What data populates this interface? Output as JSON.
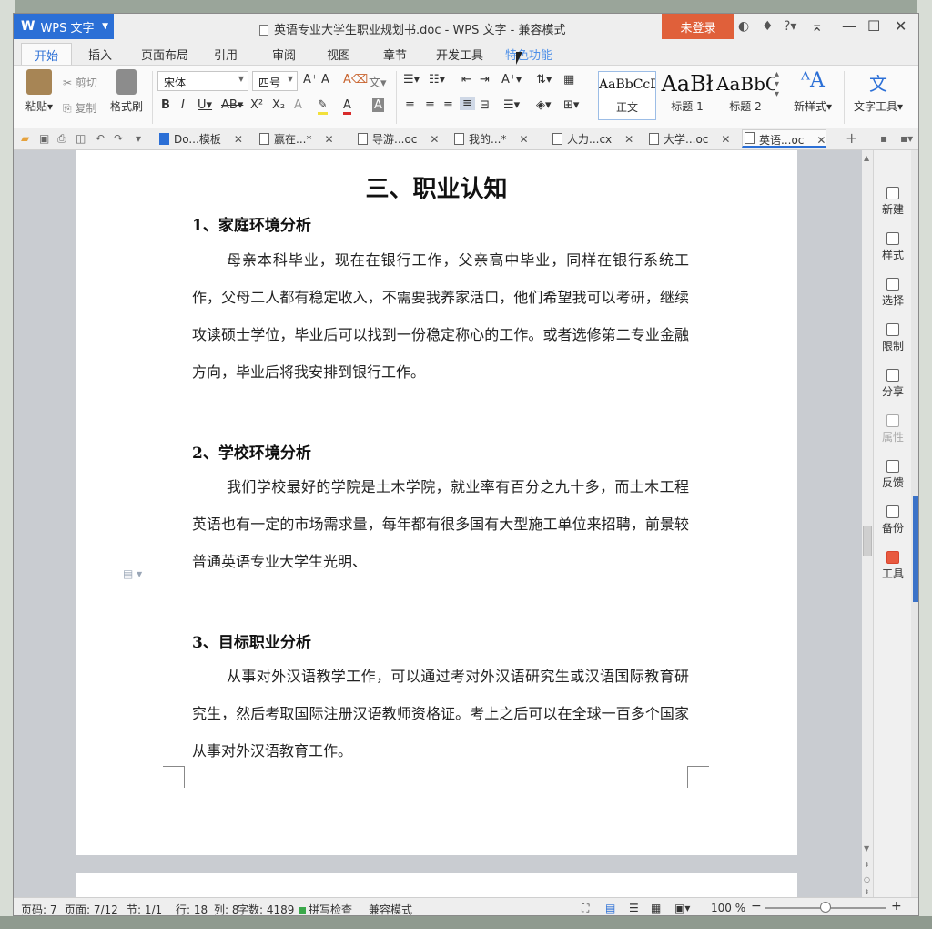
{
  "app": {
    "name": "WPS 文字",
    "logo": "W"
  },
  "window": {
    "title": "英语专业大学生职业规划书.doc - WPS 文字 - 兼容模式",
    "login_label": "未登录"
  },
  "ribbon_tabs": [
    "开始",
    "插入",
    "页面布局",
    "引用",
    "审阅",
    "视图",
    "章节",
    "开发工具",
    "特色功能"
  ],
  "ribbon": {
    "paste": "粘贴",
    "cut": "剪切",
    "copy": "复制",
    "format_painter": "格式刷",
    "font_name": "宋体",
    "font_size": "四号",
    "styles": [
      {
        "sample": "AaBbCcD",
        "label": "正文"
      },
      {
        "sample": "AaBł",
        "label": "标题 1"
      },
      {
        "sample": "AaBbC",
        "label": "标题 2"
      }
    ],
    "new_style": "新样式",
    "text_tools": "文字工具"
  },
  "doc_tabs": [
    {
      "label": "Do...模板",
      "active": false
    },
    {
      "label": "赢在...*",
      "active": false
    },
    {
      "label": "导游...oc",
      "active": false
    },
    {
      "label": "我的...*",
      "active": false
    },
    {
      "label": "人力...cx",
      "active": false
    },
    {
      "label": "大学...oc",
      "active": false
    },
    {
      "label": "英语...oc",
      "active": true
    }
  ],
  "document": {
    "heading": "三、职业认知",
    "sections": [
      {
        "title": "1、家庭环境分析",
        "text": "母亲本科毕业，现在在银行工作，父亲高中毕业，同样在银行系统工作，父母二人都有稳定收入，不需要我养家活口，他们希望我可以考研，继续攻读硕士学位，毕业后可以找到一份稳定称心的工作。或者选修第二专业金融方向，毕业后将我安排到银行工作。"
      },
      {
        "title": "2、学校环境分析",
        "text": "我们学校最好的学院是土木学院，就业率有百分之九十多，而土木工程英语也有一定的市场需求量，每年都有很多国有大型施工单位来招聘，前景较普通英语专业大学生光明、"
      },
      {
        "title": "3、目标职业分析",
        "text": "从事对外汉语教学工作，可以通过考对外汉语研究生或汉语国际教育研究生，然后考取国际注册汉语教师资格证。考上之后可以在全球一百多个国家从事对外汉语教育工作。"
      }
    ]
  },
  "task_pane": [
    {
      "label": "新建",
      "icon": "new-doc-icon"
    },
    {
      "label": "样式",
      "icon": "style-icon"
    },
    {
      "label": "选择",
      "icon": "select-icon"
    },
    {
      "label": "限制",
      "icon": "restrict-icon"
    },
    {
      "label": "分享",
      "icon": "share-icon"
    },
    {
      "label": "属性",
      "icon": "properties-icon"
    },
    {
      "label": "反馈",
      "icon": "feedback-icon"
    },
    {
      "label": "备份",
      "icon": "backup-icon"
    },
    {
      "label": "工具",
      "icon": "toolbox-icon"
    }
  ],
  "status": {
    "page_no": "页码: 7",
    "pages": "页面: 7/12",
    "section": "节: 1/1",
    "row": "行: 18",
    "col": "列: 8",
    "word_count": "字数: 4189",
    "spell_check": "拼写检查",
    "compat_mode": "兼容模式",
    "zoom": "100 %"
  },
  "colors": {
    "accent": "#2b6fd6",
    "login": "#e0603a"
  }
}
